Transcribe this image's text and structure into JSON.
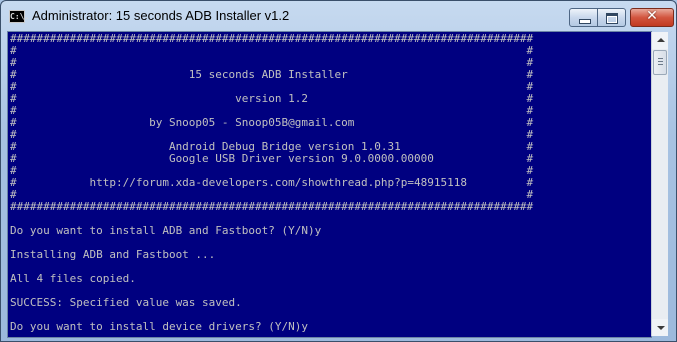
{
  "window": {
    "icon_text": "C:\\.",
    "title": "Administrator:  15 seconds ADB Installer v1.2"
  },
  "console": {
    "lines": [
      "###############################################################################",
      "#                                                                             #",
      "#                                                                             #",
      "#                          15 seconds ADB Installer                           #",
      "#                                                                             #",
      "#                                 version 1.2                                 #",
      "#                                                                             #",
      "#                    by Snoop05 - Snoop05B@gmail.com                          #",
      "#                                                                             #",
      "#                       Android Debug Bridge version 1.0.31                   #",
      "#                       Google USB Driver version 9.0.0000.00000              #",
      "#                                                                             #",
      "#           http://forum.xda-developers.com/showthread.php?p=48915118         #",
      "#                                                                             #",
      "###############################################################################",
      "",
      "Do you want to install ADB and Fastboot? (Y/N)y",
      "",
      "Installing ADB and Fastboot ...",
      "",
      "All 4 files copied.",
      "",
      "SUCCESS: Specified value was saved.",
      "",
      "Do you want to install device drivers? (Y/N)y"
    ]
  }
}
